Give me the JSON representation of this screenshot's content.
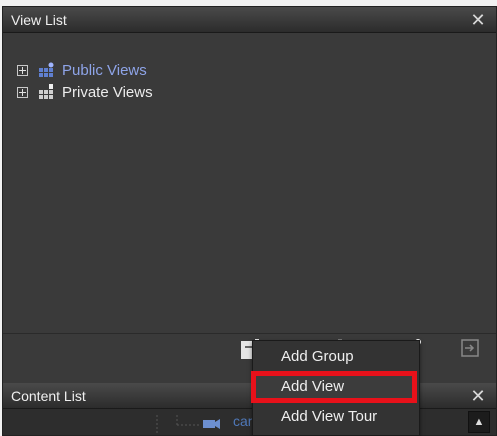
{
  "view_list": {
    "title": "View List",
    "close_glyph": "✕",
    "tree": [
      {
        "label": "Public Views",
        "icon": "public-views-icon",
        "color": "#8ea4e8"
      },
      {
        "label": "Private Views",
        "icon": "private-views-icon",
        "color": "#ececec"
      }
    ]
  },
  "content_list": {
    "title": "Content List",
    "close_glyph": "✕",
    "visible_item": "cam",
    "scroll_glyph": "▲"
  },
  "context_menu": {
    "items": [
      {
        "label": "Add Group"
      },
      {
        "label": "Add View",
        "highlighted": true
      },
      {
        "label": "Add View Tour"
      }
    ],
    "highlight_color": "#e8111a"
  }
}
